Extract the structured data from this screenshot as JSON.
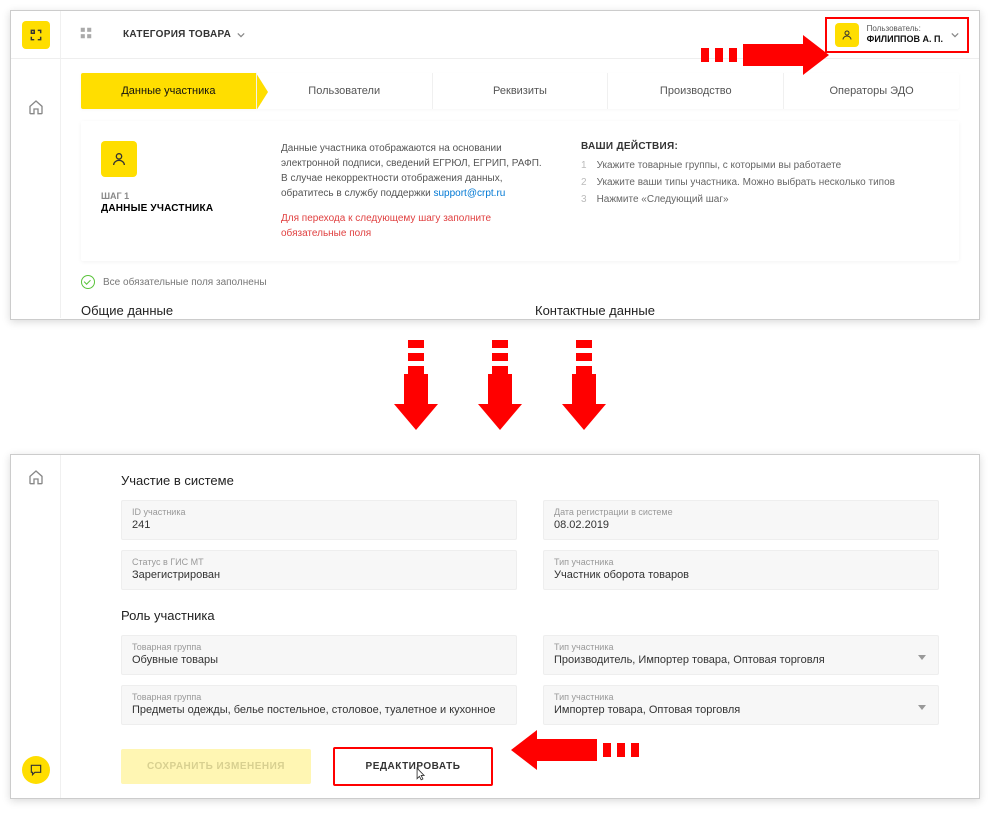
{
  "topbar": {
    "category_label": "КАТЕГОРИЯ ТОВАРА",
    "user_role_label": "Пользователь:",
    "user_name": "ФИЛИППОВ А. П."
  },
  "tabs": [
    "Данные участника",
    "Пользователи",
    "Реквизиты",
    "Производство",
    "Операторы ЭДО"
  ],
  "step": {
    "step_label": "ШАГ 1",
    "title": "ДАННЫЕ УЧАСТНИКА",
    "desc": "Данные участника отображаются на основании электронной подписи, сведений ЕГРЮЛ, ЕГРИП, РАФП. В случае некорректности отображения данных, обратитесь в службу поддержки ",
    "support_email": "support@crpt.ru",
    "warn": "Для перехода к следующему шагу заполните обязательные поля"
  },
  "actions": {
    "title": "ВАШИ ДЕЙСТВИЯ:",
    "items": [
      "Укажите товарные группы, с которыми вы работаете",
      "Укажите ваши типы участника. Можно выбрать несколько типов",
      "Нажмите «Следующий шаг»"
    ]
  },
  "status_ok": "Все обязательные поля заполнены",
  "section_general": "Общие данные",
  "section_contact": "Контактные данные",
  "participation": {
    "title": "Участие в системе",
    "id_label": "ID участника",
    "id_value": "241",
    "date_label": "Дата регистрации в системе",
    "date_value": "08.02.2019",
    "status_label": "Статус в ГИС МТ",
    "status_value": "Зарегистрирован",
    "type_label": "Тип участника",
    "type_value": "Участник оборота товаров"
  },
  "role": {
    "title": "Роль участника",
    "group_label": "Товарная группа",
    "type_label": "Тип участника",
    "rows": [
      {
        "group": "Обувные товары",
        "type": "Производитель, Импортер товара, Оптовая торговля"
      },
      {
        "group": "Предметы одежды, белье постельное, столовое, туалетное и кухонное",
        "type": "Импортер товара, Оптовая торговля"
      }
    ]
  },
  "buttons": {
    "save": "СОХРАНИТЬ ИЗМЕНЕНИЯ",
    "edit": "РЕДАКТИРОВАТЬ"
  }
}
